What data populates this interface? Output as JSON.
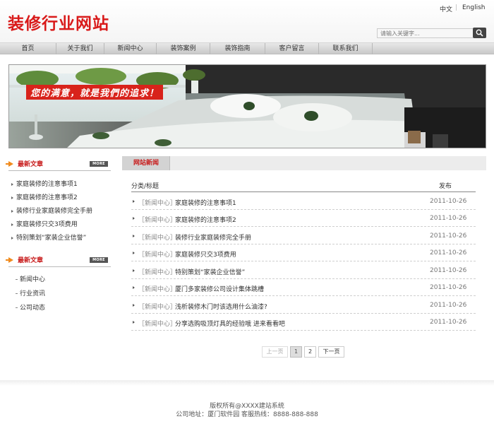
{
  "header": {
    "site_title": "装修行业网站",
    "lang_cn": "中文",
    "lang_sep": "|",
    "lang_en": "English",
    "search_placeholder": "请输入关键字...",
    "search_icon": "search-icon"
  },
  "nav": {
    "items": [
      "首页",
      "关于我们",
      "新闻中心",
      "装饰案例",
      "装饰指南",
      "客户留言",
      "联系我们"
    ]
  },
  "banner": {
    "slogan": "您的满意，就是我們的追求！"
  },
  "sidebar": {
    "articles_title": "最新文章",
    "more_label": "MORE",
    "articles": [
      "家庭装修的注意事项1",
      "家庭装修的注意事项2",
      "装修行业家庭装修完全手册",
      "家庭装修只交3项费用",
      "特别策划“家装企业信誉”"
    ],
    "categories_title": "最新文章",
    "categories": [
      "新闻中心",
      "行业资讯",
      "公司动态"
    ]
  },
  "main": {
    "tab_label": "网站新闻",
    "col_title": "分类/标题",
    "col_date": "发布",
    "rows": [
      {
        "cat": "［新闻中心］",
        "title": "家庭装修的注意事项1",
        "date": "2011-10-26"
      },
      {
        "cat": "［新闻中心］",
        "title": "家庭装修的注意事项2",
        "date": "2011-10-26"
      },
      {
        "cat": "［新闻中心］",
        "title": "装修行业家庭装修完全手册",
        "date": "2011-10-26"
      },
      {
        "cat": "［新闻中心］",
        "title": "家庭装修只交3项费用",
        "date": "2011-10-26"
      },
      {
        "cat": "［新闻中心］",
        "title": "特别策划“家装企业信誉”",
        "date": "2011-10-26"
      },
      {
        "cat": "［新闻中心］",
        "title": "厦门多家装修公司设计集体跳槽",
        "date": "2011-10-26"
      },
      {
        "cat": "［新闻中心］",
        "title": "浅析装修木门时该选用什么油漆?",
        "date": "2011-10-26"
      },
      {
        "cat": "［新闻中心］",
        "title": "分享选购吸顶灯具的经验哦 进来看看吧",
        "date": "2011-10-26"
      }
    ]
  },
  "pagination": {
    "prev": "上一页",
    "pages": [
      "1",
      "2"
    ],
    "next": "下一页",
    "current": "1"
  },
  "footer": {
    "copyright": "版权所有@XXXX建站系统",
    "address": "公司地址：厦门软件园 客服热线：8888-888-888"
  },
  "colors": {
    "brand_red": "#d91a1a",
    "accent_orange": "#f08a1c"
  }
}
